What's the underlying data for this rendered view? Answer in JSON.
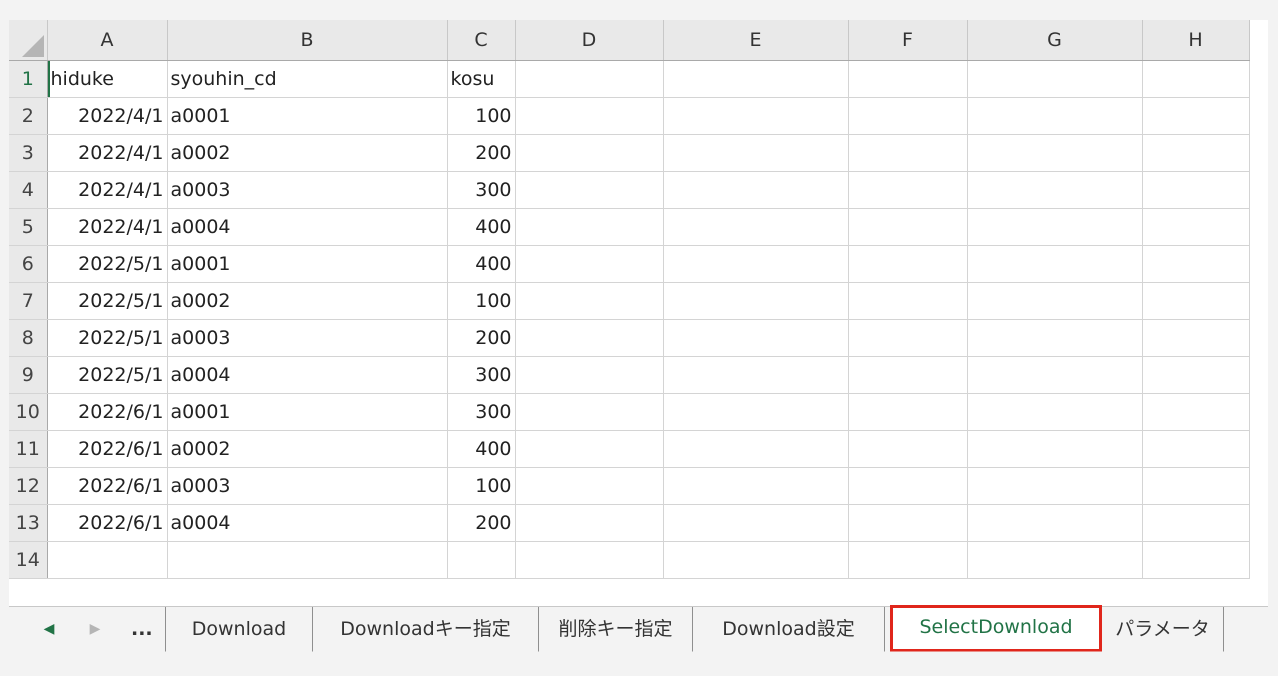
{
  "columns": [
    "A",
    "B",
    "C",
    "D",
    "E",
    "F",
    "G",
    "H"
  ],
  "rows": [
    {
      "num": "1",
      "a": "hiduke",
      "b": "syouhin_cd",
      "c": "kosu"
    },
    {
      "num": "2",
      "a": "2022/4/1",
      "b": "a0001",
      "c": "100"
    },
    {
      "num": "3",
      "a": "2022/4/1",
      "b": "a0002",
      "c": "200"
    },
    {
      "num": "4",
      "a": "2022/4/1",
      "b": "a0003",
      "c": "300"
    },
    {
      "num": "5",
      "a": "2022/4/1",
      "b": "a0004",
      "c": "400"
    },
    {
      "num": "6",
      "a": "2022/5/1",
      "b": "a0001",
      "c": "400"
    },
    {
      "num": "7",
      "a": "2022/5/1",
      "b": "a0002",
      "c": "100"
    },
    {
      "num": "8",
      "a": "2022/5/1",
      "b": "a0003",
      "c": "200"
    },
    {
      "num": "9",
      "a": "2022/5/1",
      "b": "a0004",
      "c": "300"
    },
    {
      "num": "10",
      "a": "2022/6/1",
      "b": "a0001",
      "c": "300"
    },
    {
      "num": "11",
      "a": "2022/6/1",
      "b": "a0002",
      "c": "400"
    },
    {
      "num": "12",
      "a": "2022/6/1",
      "b": "a0003",
      "c": "100"
    },
    {
      "num": "13",
      "a": "2022/6/1",
      "b": "a0004",
      "c": "200"
    },
    {
      "num": "14",
      "a": "",
      "b": "",
      "c": ""
    }
  ],
  "tabbar": {
    "prev_icon": "◀",
    "next_icon": "▶",
    "more_label": "...",
    "tabs": [
      "Download",
      "Downloadキー指定",
      "削除キー指定",
      "Download設定",
      "SelectDownload",
      "パラメータ"
    ],
    "active_tab": "SelectDownload"
  },
  "colors": {
    "accent": "#217346",
    "highlight_border": "#e0261b"
  }
}
